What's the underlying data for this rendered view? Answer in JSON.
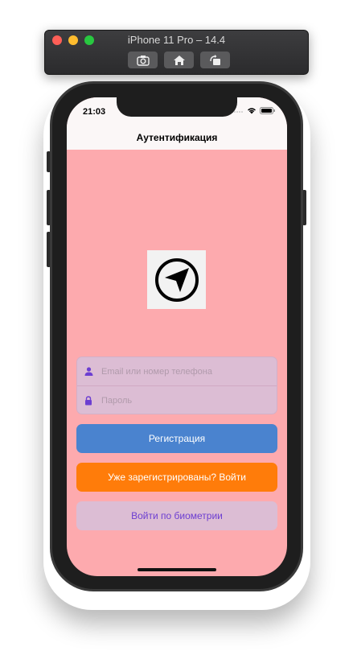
{
  "simulator": {
    "title": "iPhone 11 Pro – 14.4",
    "buttons": [
      "screenshot-icon",
      "home-icon",
      "rotate-icon"
    ]
  },
  "status_bar": {
    "time": "21:03"
  },
  "nav": {
    "title": "Аутентификация"
  },
  "logo": {
    "icon": "navigation-arrow-icon"
  },
  "form": {
    "login_placeholder": "Email или номер телефона",
    "password_placeholder": "Пароль"
  },
  "buttons": {
    "register": "Регистрация",
    "login": "Уже зарегистрированы? Войти",
    "biometric": "Войти по биометрии"
  },
  "colors": {
    "background": "#fdaaae",
    "register": "#4a83cf",
    "login": "#ff7c0a",
    "biometric_text": "#6c3ed1",
    "field_icon": "#6c3ed1"
  }
}
